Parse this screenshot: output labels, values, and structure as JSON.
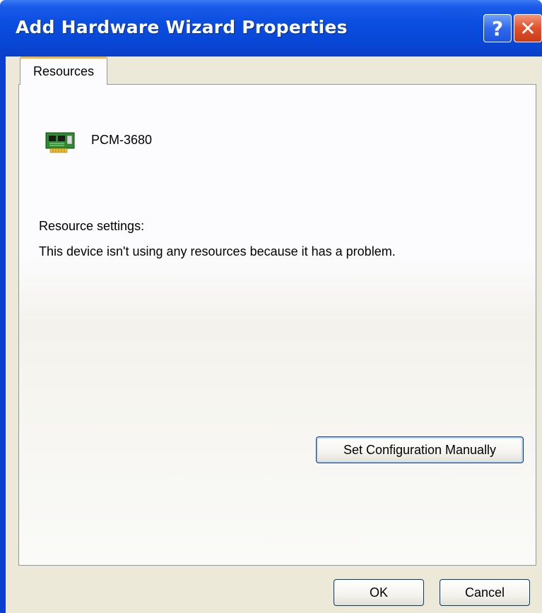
{
  "window": {
    "title": "Add Hardware Wizard Properties",
    "help_label": "?",
    "close_label": "✕"
  },
  "tabs": [
    {
      "label": "Resources",
      "active": true
    }
  ],
  "device": {
    "name": "PCM-3680",
    "icon": "pci-card-icon"
  },
  "resources": {
    "heading": "Resource settings:",
    "message": "This device isn't using any resources because it has a problem."
  },
  "buttons": {
    "set_config": "Set Configuration Manually",
    "ok": "OK",
    "cancel": "Cancel"
  },
  "colors": {
    "titlebar": "#0a4ee0",
    "tab_highlight": "#f5b640",
    "dialog_face": "#ece9d8",
    "close_button": "#e0502a"
  }
}
